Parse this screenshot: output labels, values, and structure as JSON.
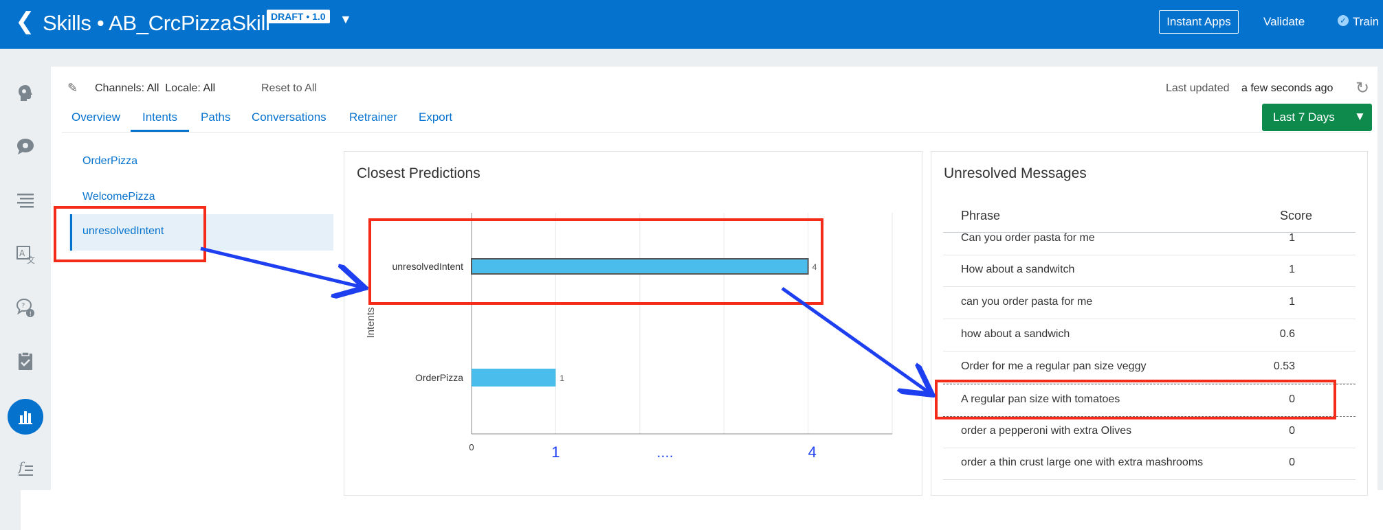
{
  "header": {
    "back_icon": "chevron-left-icon",
    "title": "Skills • AB_CrcPizzaSkill",
    "badge": "DRAFT • 1.0",
    "instant_apps": "Instant Apps",
    "validate": "Validate",
    "train": "Train"
  },
  "sidebar": {
    "items": [
      {
        "icon": "intent-head-icon"
      },
      {
        "icon": "entity-bubble-icon"
      },
      {
        "icon": "flows-list-icon"
      },
      {
        "icon": "translate-icon"
      },
      {
        "icon": "help-chat-icon"
      },
      {
        "icon": "clipboard-check-icon"
      },
      {
        "icon": "insights-chart-icon",
        "active": true
      },
      {
        "icon": "function-icon"
      }
    ]
  },
  "toolbar": {
    "channels_label": "Channels:",
    "channels_value": "All",
    "locale_label": "Locale:",
    "locale_value": "All",
    "reset": "Reset to All",
    "last_updated_label": "Last updated",
    "last_updated_value": "a few seconds ago"
  },
  "tabs": [
    "Overview",
    "Intents",
    "Paths",
    "Conversations",
    "Retrainer",
    "Export"
  ],
  "active_tab": "Intents",
  "date_range": "Last 7 Days",
  "intents": [
    "OrderPizza",
    "WelcomePizza",
    "unresolvedIntent"
  ],
  "selected_intent": "unresolvedIntent",
  "predictions": {
    "title": "Closest Predictions"
  },
  "chart_data": {
    "type": "bar",
    "orientation": "horizontal",
    "title": "Closest Predictions",
    "ylabel": "Intents",
    "categories": [
      "unresolvedIntent",
      "OrderPizza"
    ],
    "values": [
      4,
      1
    ],
    "xlim": [
      0,
      5
    ],
    "x_ticks": [
      "0"
    ],
    "highlight_category": "unresolvedIntent",
    "bar_color": "#4bbdec"
  },
  "annotations": {
    "axis_markers": [
      "1",
      "....",
      "4"
    ],
    "color": "#f52b1a",
    "arrow_color": "#1e3ff0"
  },
  "unresolved": {
    "title": "Unresolved Messages",
    "columns": [
      "Phrase",
      "Score"
    ],
    "rows": [
      {
        "phrase": "Can you order pasta for me",
        "score": "1"
      },
      {
        "phrase": "How about a sandwitch",
        "score": "1"
      },
      {
        "phrase": "can you order pasta for me",
        "score": "1"
      },
      {
        "phrase": "how about a sandwich",
        "score": "0.6"
      },
      {
        "phrase": "Order for me a regular pan size veggy",
        "score": "0.53"
      },
      {
        "phrase": "A regular pan size with tomatoes",
        "score": "0"
      },
      {
        "phrase": "order a pepperoni with extra Olives",
        "score": "0"
      },
      {
        "phrase": "order a thin crust large one with extra mashrooms",
        "score": "0"
      }
    ]
  }
}
